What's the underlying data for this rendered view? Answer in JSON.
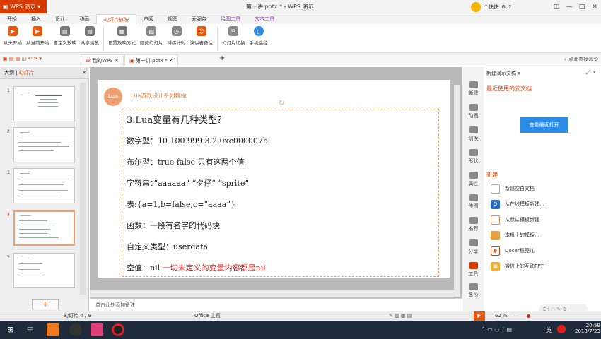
{
  "app": {
    "name": "WPS 演示",
    "doc_title": "第一讲.pptx * - WPS 演示"
  },
  "user": {
    "label": "个快快",
    "help": "?"
  },
  "menu_tabs": [
    "开始",
    "插入",
    "设计",
    "动画",
    "幻灯片放映",
    "审阅",
    "视图",
    "云服务",
    "绘图工具",
    "文本工具"
  ],
  "ribbon": [
    "从头开始",
    "从当前开始",
    "自定义放映",
    "共享播放",
    "设置放映方式",
    "隐藏幻灯片",
    "排练计时",
    "演讲者备注",
    "幻灯片切换",
    "手机遥控"
  ],
  "doc_tabs": {
    "mywps": "我的WPS",
    "file": "第一讲.pptx *",
    "search": "点此查找命令"
  },
  "left_panel": {
    "outline": "大纲",
    "slides": "幻灯片",
    "numbers": [
      "1",
      "2",
      "3",
      "4",
      "5"
    ]
  },
  "slide": {
    "header": "Lua游戏设计系列教程",
    "logo": "Lua",
    "title": "3.Lua变量有几种类型？",
    "lines": [
      "数字型：10 100 999 3.2 0xc000007b",
      "布尔型：true false 只有这两个值",
      "字符串：”aaaaaa” “夕仔” “sprite”",
      "表:{a=1,b=false,c=”aaaa”}",
      "函数：一段有名字的代码块",
      "自定义类型：userdata"
    ],
    "last_line_prefix": "空值：nil ",
    "last_line_red": "一切未定义的变量内容都是nil"
  },
  "notes_placeholder": "单击此处添加备注",
  "right_tools": [
    "新建",
    "动画",
    "切换",
    "形状",
    "属性",
    "传图",
    "推荐",
    "分享",
    "工具",
    "备份"
  ],
  "right_pane": {
    "header": "新建演示文稿 ▾",
    "recent_title": "最近使用的云文档",
    "view_recent_btn": "查看最近打开",
    "new_title": "新建",
    "items": [
      "新建空白文档",
      "从在线模板新建...",
      "从默认模板新建",
      "本机上的模板...",
      "Docer稻壳儿",
      "微信上的互动PPT"
    ]
  },
  "status": {
    "slide_info": "幻灯片 4 / 9",
    "theme": "Office 主题",
    "zoom": "62 %"
  },
  "taskbar": {
    "ime": "英",
    "time": "20:59",
    "date": "2018/7/23",
    "lang_float": "En"
  },
  "colors": {
    "wps_red": "#d83b01",
    "accent_orange": "#f0a070",
    "text_red": "#e02020",
    "button_blue": "#2b8ce8"
  }
}
